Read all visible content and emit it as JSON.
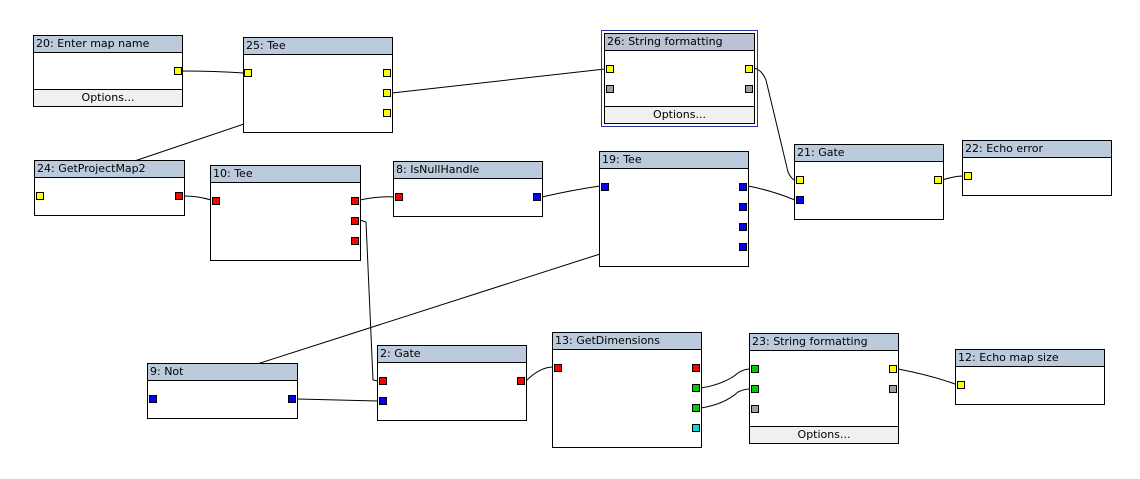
{
  "colors": {
    "background": "#ffffff",
    "title_bar": "#bccbdc",
    "wire": "#000000",
    "selection": "#2e2ea6",
    "port_yellow": "#ffff00",
    "port_red": "#ff0000",
    "port_blue": "#0000ff",
    "port_green": "#00cc00",
    "port_cyan": "#00dede",
    "port_gray": "#a0a0a0"
  },
  "nodes": [
    {
      "id": "n20",
      "title": "20: Enter map name",
      "options": "Options..."
    },
    {
      "id": "n25",
      "title": "25: Tee"
    },
    {
      "id": "n26",
      "title": "26: String formatting",
      "options": "Options...",
      "selected": true
    },
    {
      "id": "n24",
      "title": "24: GetProjectMap2"
    },
    {
      "id": "n10",
      "title": "10: Tee"
    },
    {
      "id": "n8",
      "title": "8: IsNullHandle"
    },
    {
      "id": "n19",
      "title": "19: Tee"
    },
    {
      "id": "n21",
      "title": "21: Gate"
    },
    {
      "id": "n22",
      "title": "22: Echo error"
    },
    {
      "id": "n9",
      "title": "9: Not"
    },
    {
      "id": "n2",
      "title": "2: Gate"
    },
    {
      "id": "n13",
      "title": "13: GetDimensions"
    },
    {
      "id": "n23",
      "title": "23: String formatting",
      "options": "Options..."
    },
    {
      "id": "n12",
      "title": "12: Echo map size"
    }
  ]
}
